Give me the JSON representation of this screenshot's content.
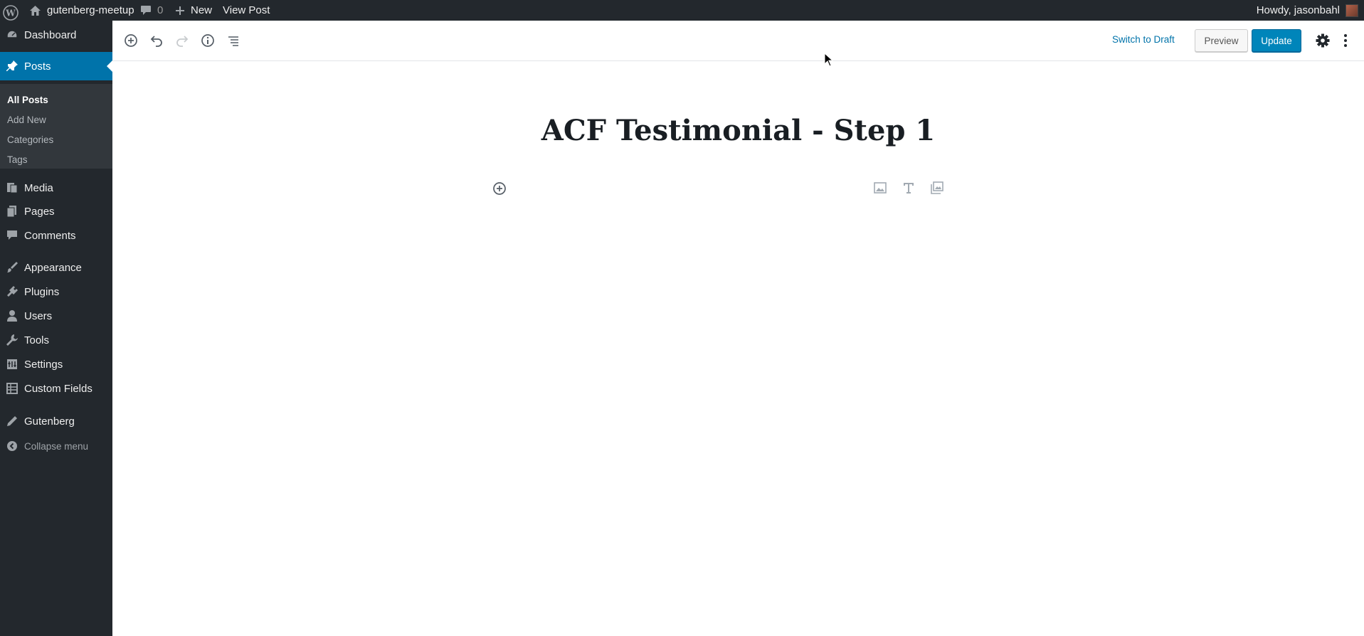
{
  "admin_bar": {
    "site_name": "gutenberg-meetup",
    "comments_count": "0",
    "new_label": "New",
    "view_post_label": "View Post",
    "howdy": "Howdy, jasonbahl",
    "icons": [
      "wordpress-logo-icon",
      "home-icon",
      "comment-icon",
      "plus-icon",
      "avatar"
    ]
  },
  "sidebar": {
    "items": [
      {
        "label": "Dashboard",
        "icon": "dashboard-icon"
      },
      {
        "label": "Posts",
        "icon": "pin-icon",
        "current": true
      },
      {
        "label": "Media",
        "icon": "media-icon"
      },
      {
        "label": "Pages",
        "icon": "pages-icon"
      },
      {
        "label": "Comments",
        "icon": "comments-icon"
      },
      {
        "label": "Appearance",
        "icon": "brush-icon"
      },
      {
        "label": "Plugins",
        "icon": "plugin-icon"
      },
      {
        "label": "Users",
        "icon": "user-icon"
      },
      {
        "label": "Tools",
        "icon": "wrench-icon"
      },
      {
        "label": "Settings",
        "icon": "settings-icon"
      },
      {
        "label": "Custom Fields",
        "icon": "table-icon"
      },
      {
        "label": "Gutenberg",
        "icon": "pencil-icon"
      }
    ],
    "submenu": [
      {
        "label": "All Posts",
        "current": true
      },
      {
        "label": "Add New"
      },
      {
        "label": "Categories"
      },
      {
        "label": "Tags"
      }
    ],
    "collapse_label": "Collapse menu"
  },
  "toolbar": {
    "switch_to_draft": "Switch to Draft",
    "preview": "Preview",
    "update": "Update",
    "icons": [
      "add-block-icon",
      "undo-icon",
      "redo-icon",
      "info-icon",
      "outline-icon",
      "gear-icon",
      "more-options-icon"
    ]
  },
  "post": {
    "title": "ACF Testimonial - Step 1"
  },
  "colors": {
    "admin_bg": "#23282d",
    "accent": "#0073aa",
    "update_button": "#0085ba"
  }
}
